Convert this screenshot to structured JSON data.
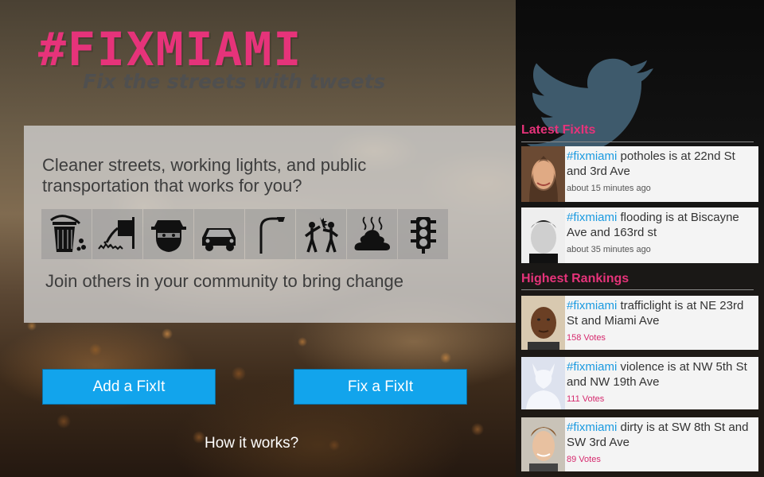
{
  "header": {
    "logo": "#FIXMIAMI",
    "tagline": "Fix the streets with tweets"
  },
  "intro": {
    "description": "Cleaner streets, working lights, and public transportation that works for you?",
    "call_to_action": "Join others in your community to bring change",
    "issue_icons": [
      "trash-can-icon",
      "sewage-pipe-icon",
      "burglar-icon",
      "car-icon",
      "streetlight-icon",
      "fight-icon",
      "poop-icon",
      "traffic-light-icon"
    ]
  },
  "actions": {
    "add_label": "Add a FixIt",
    "fix_label": "Fix a FixIt",
    "how_label": "How it works?"
  },
  "latest": {
    "title": "Latest FixIts",
    "items": [
      {
        "hashtag": "#fixmiami",
        "text": " potholes is at 22nd St and 3rd Ave",
        "meta": "about 15 minutes ago"
      },
      {
        "hashtag": "#fixmiami",
        "text": " flooding is at Biscayne Ave and 163rd st",
        "meta": "about 35 minutes ago"
      }
    ]
  },
  "rankings": {
    "title": "Highest Rankings",
    "items": [
      {
        "hashtag": "#fixmiami",
        "text": " trafficlight is at NE 23rd St and Miami Ave",
        "votes": "158 Votes"
      },
      {
        "hashtag": "#fixmiami",
        "text": " violence is at NW 5th St and NW 19th Ave",
        "votes": "111 Votes"
      },
      {
        "hashtag": "#fixmiami",
        "text": " dirty is at SW 8th St and SW 3rd Ave",
        "votes": "89 Votes"
      }
    ]
  },
  "colors": {
    "brand_pink": "#e6337a",
    "button_blue": "#12a4ec",
    "hashtag_blue": "#1b9ae0"
  }
}
